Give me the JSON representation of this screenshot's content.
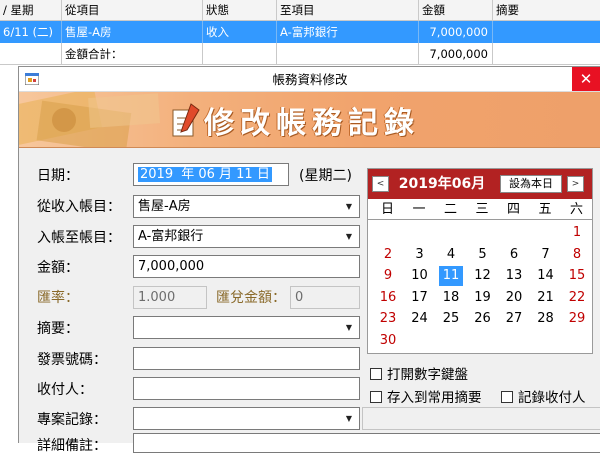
{
  "grid": {
    "headers": [
      "/ 星期",
      "從項目",
      "狀態",
      "至項目",
      "金額",
      "摘要"
    ],
    "row": [
      "6/11 (二)",
      "售屋-A房",
      "收入",
      "A-富邦銀行",
      "7,000,000",
      ""
    ],
    "total_label": "金額合計：",
    "total_value": "7,000,000"
  },
  "dialog": {
    "title": "帳務資料修改",
    "close": "✕",
    "banner": "修改帳務記錄",
    "icon": "app-window-icon"
  },
  "form": {
    "date_label": "日期：",
    "date_year": "2019",
    "date_rest": " 年 06 月 11 日",
    "weekday": "(星期二)",
    "from_label": "從收入帳目：",
    "from_value": "售屋-A房",
    "to_label": "入帳至帳目：",
    "to_value": "A-富邦銀行",
    "amount_label": "金額：",
    "amount_value": "7,000,000",
    "rate_label": "匯率：",
    "rate_value": "1.000",
    "fx_label": "匯兌金額：",
    "fx_value": "0",
    "memo_label": "摘要：",
    "memo_value": "",
    "invoice_label": "發票號碼：",
    "invoice_value": "",
    "payer_label": "收付人：",
    "payer_value": "",
    "project_label": "專案記錄：",
    "project_value": "",
    "detail_label": "詳細備註："
  },
  "calendar": {
    "title": "2019年06月",
    "today_button": "設為本日",
    "prev": "<",
    "next": ">",
    "weekdays": [
      "日",
      "一",
      "二",
      "三",
      "四",
      "五",
      "六"
    ],
    "selected": 11,
    "days": [
      [
        "",
        "",
        "",
        "",
        "",
        "",
        "1"
      ],
      [
        "2",
        "3",
        "4",
        "5",
        "6",
        "7",
        "8"
      ],
      [
        "9",
        "10",
        "11",
        "12",
        "13",
        "14",
        "15"
      ],
      [
        "16",
        "17",
        "18",
        "19",
        "20",
        "21",
        "22"
      ],
      [
        "23",
        "24",
        "25",
        "26",
        "27",
        "28",
        "29"
      ],
      [
        "30",
        "",
        "",
        "",
        "",
        "",
        ""
      ]
    ]
  },
  "options": {
    "numpad": "打開數字鍵盤",
    "save_memo": "存入到常用摘要",
    "record_payer": "記錄收付人"
  },
  "colors": {
    "selection": "#3399ff",
    "calendar_header": "#b22222",
    "close_button": "#e81123",
    "weekend": "#c00000"
  }
}
